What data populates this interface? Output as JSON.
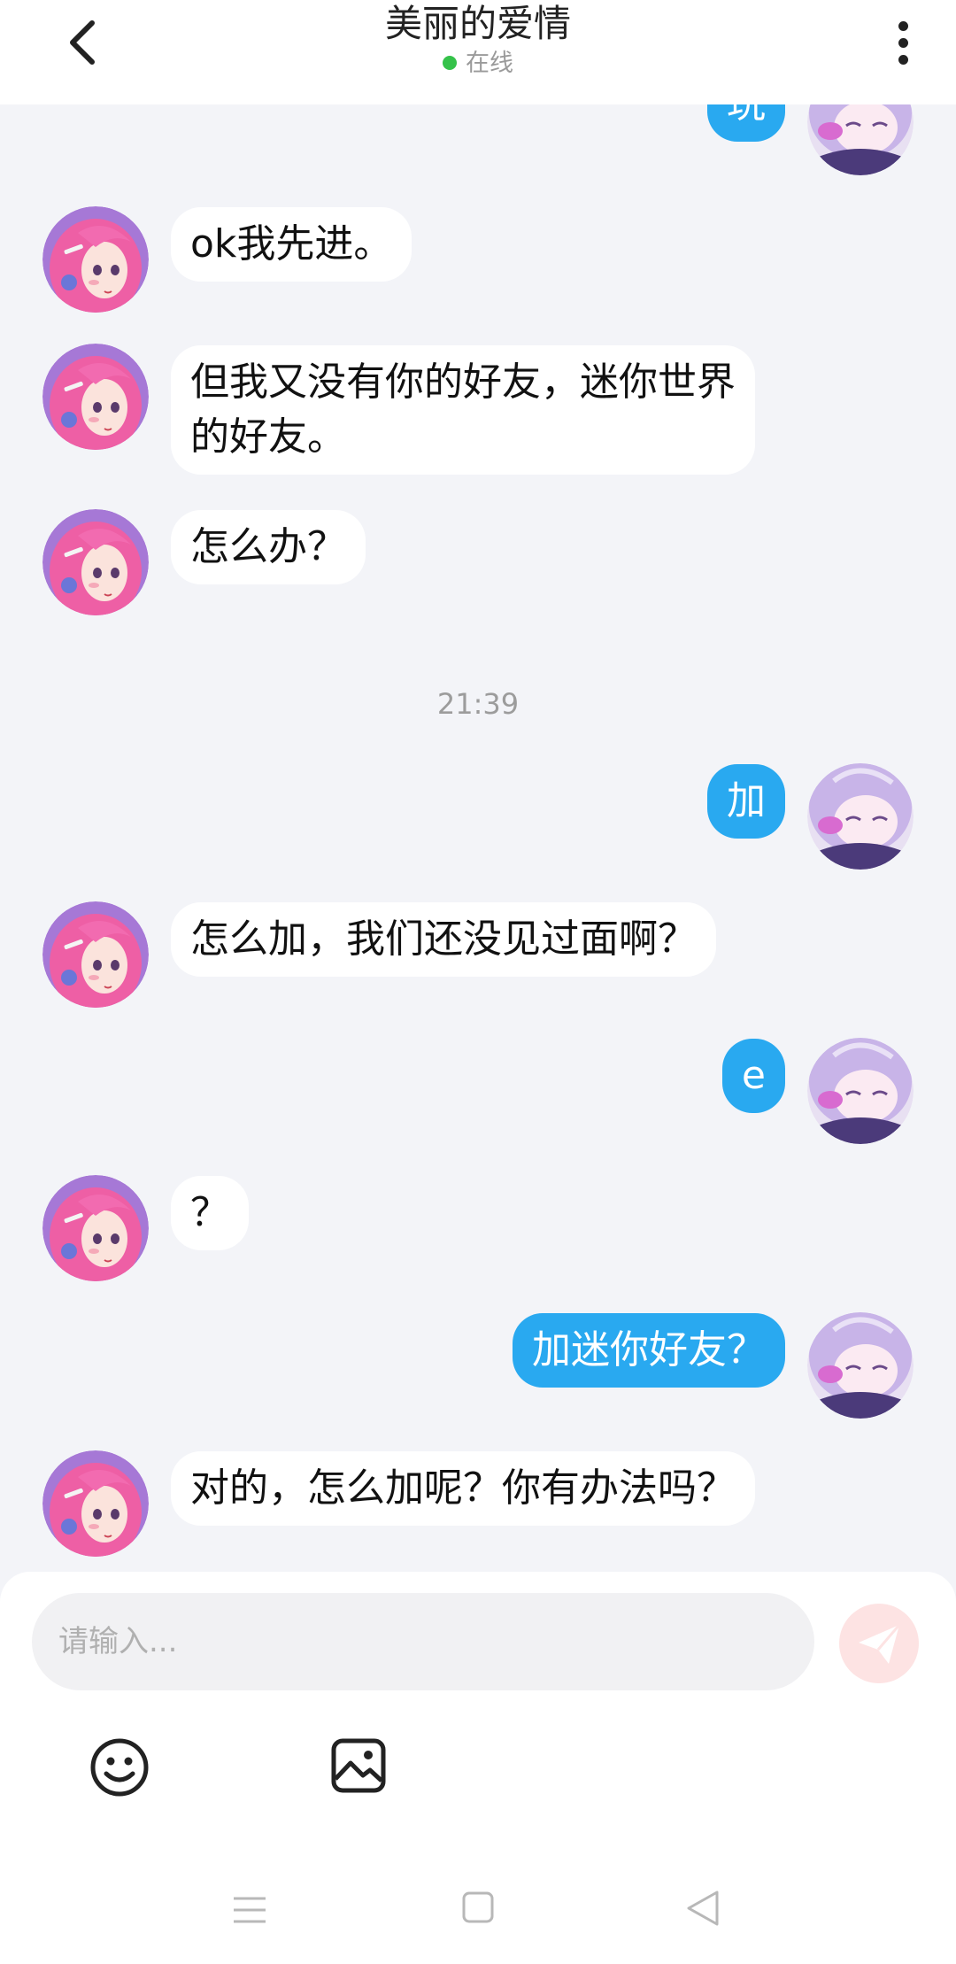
{
  "header": {
    "title": "美丽的爱情",
    "status": "在线"
  },
  "messages": [
    {
      "from": "me",
      "text": "玩"
    },
    {
      "from": "them",
      "text": "ok我先进。"
    },
    {
      "from": "them",
      "line1": "但我又没有你的好友，迷你世界",
      "line2": "的好友。"
    },
    {
      "from": "them",
      "text": "怎么办？"
    },
    {
      "type": "timestamp",
      "text": "21:39"
    },
    {
      "from": "me",
      "text": "加"
    },
    {
      "from": "them",
      "text": "怎么加，我们还没见过面啊？"
    },
    {
      "from": "me",
      "text": "e"
    },
    {
      "from": "them",
      "text": "？"
    },
    {
      "from": "me",
      "text": "加迷你好友？"
    },
    {
      "from": "them",
      "text": "对的，怎么加呢？你有办法吗？"
    }
  ],
  "input": {
    "placeholder": "请输入..."
  },
  "toolbar": {
    "icons": [
      "emoji-icon",
      "image-icon"
    ]
  },
  "colors": {
    "my_bubble": "#29a9f0",
    "their_bubble": "#ffffff",
    "background": "#f3f4f8",
    "online_dot": "#35c24a",
    "send_button": "#fde3e3"
  }
}
